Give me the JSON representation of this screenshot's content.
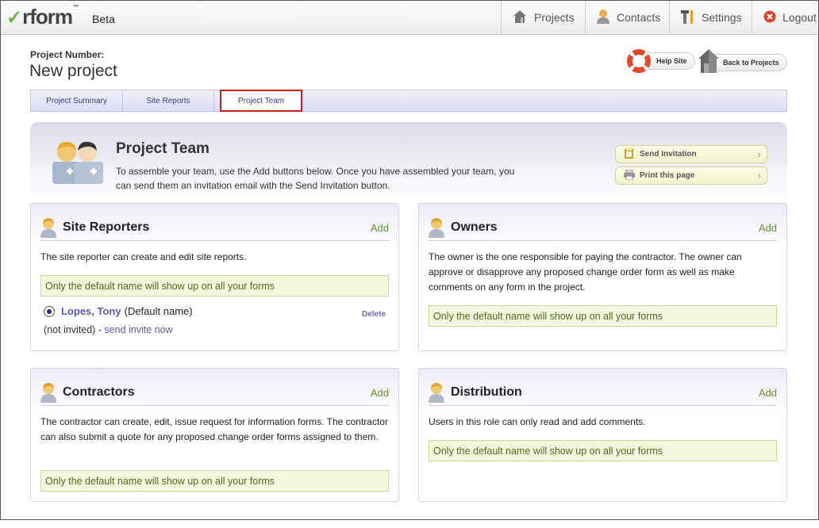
{
  "app": {
    "logo_text": "rform",
    "logo_tm": "™",
    "beta_label": "Beta"
  },
  "nav": {
    "projects": "Projects",
    "contacts": "Contacts",
    "settings": "Settings",
    "logout": "Logout"
  },
  "header": {
    "project_number_label": "Project Number:",
    "project_name": "New project",
    "help_site": "Help Site",
    "back_to_projects": "Back to Projects"
  },
  "tabs": [
    {
      "label": "Project Summary"
    },
    {
      "label": "Site Reports"
    },
    {
      "label": "Project Team"
    }
  ],
  "team": {
    "title": "Project Team",
    "description": "To assemble your team, use the Add buttons below. Once you have assembled your team, you can send them an invitation email with the Send Invitation button.",
    "send_invitation": "Send Invitation",
    "print_page": "Print this page"
  },
  "panels": {
    "site_reporters": {
      "title": "Site Reporters",
      "add": "Add",
      "description": "The site reporter can create and edit site reports.",
      "note": "Only the default name will show up on all your forms",
      "member": {
        "name": "Lopes, Tony",
        "suffix": "(Default name)",
        "delete": "Delete",
        "status": "(not invited) - ",
        "invite_link": "send invite now"
      }
    },
    "owners": {
      "title": "Owners",
      "add": "Add",
      "description": "The owner is the one responsible for paying the contractor. The owner can approve or disapprove any proposed change order form as well as make comments on any form in the project.",
      "note": "Only the default name will show up on all your forms"
    },
    "contractors": {
      "title": "Contractors",
      "add": "Add",
      "description": "The contractor can create, edit, issue request for information forms. The contractor can also submit a quote for any proposed change order forms assigned to them.",
      "note": "Only the default name will show up on all your forms"
    },
    "distribution": {
      "title": "Distribution",
      "add": "Add",
      "description": "Users in this role can only read and add comments.",
      "note": "Only the default name will show up on all your forms"
    }
  },
  "colors": {
    "accent_green": "#6a8f2a",
    "tab_highlight": "#d21c1c",
    "link_purple": "#5a5aa8"
  }
}
